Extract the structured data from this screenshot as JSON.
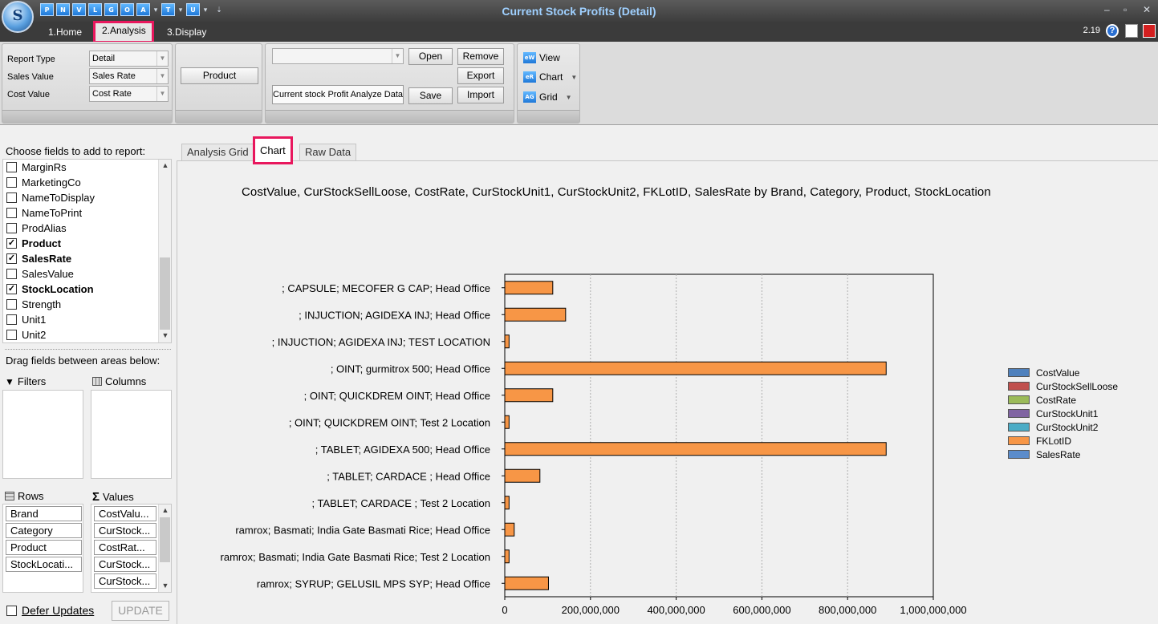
{
  "window": {
    "title": "Current Stock Profits (Detail)",
    "version": "2.19",
    "logo_text": "S",
    "quick_access": [
      "P",
      "N",
      "V",
      "L",
      "G",
      "O",
      "A",
      "T",
      "U"
    ]
  },
  "menu_tabs": [
    "1.Home",
    "2.Analysis",
    "3.Display"
  ],
  "ribbon": {
    "report_type_label": "Report Type",
    "report_type_value": "Detail",
    "sales_value_label": "Sales Value",
    "sales_value_value": "Sales Rate",
    "cost_value_label": "Cost Value",
    "cost_value_value": "Cost Rate",
    "product_button": "Product",
    "layout_select": "",
    "layout_name": "Current stock Profit Analyze Data",
    "open_button": "Open",
    "remove_button": "Remove",
    "export_button": "Export",
    "save_button": "Save",
    "import_button": "Import",
    "view_button": "View",
    "chart_button": "Chart",
    "grid_button": "Grid"
  },
  "field_panel": {
    "choose_label": "Choose fields to add to report:",
    "fields": [
      {
        "name": "MarginRs",
        "checked": false
      },
      {
        "name": "MarketingCo",
        "checked": false
      },
      {
        "name": "NameToDisplay",
        "checked": false
      },
      {
        "name": "NameToPrint",
        "checked": false
      },
      {
        "name": "ProdAlias",
        "checked": false
      },
      {
        "name": "Product",
        "checked": true
      },
      {
        "name": "SalesRate",
        "checked": true
      },
      {
        "name": "SalesValue",
        "checked": false
      },
      {
        "name": "StockLocation",
        "checked": true
      },
      {
        "name": "Strength",
        "checked": false
      },
      {
        "name": "Unit1",
        "checked": false
      },
      {
        "name": "Unit2",
        "checked": false
      }
    ],
    "drag_label": "Drag fields between areas below:",
    "filters_label": "Filters",
    "columns_label": "Columns",
    "rows_label": "Rows",
    "values_label": "Values",
    "rows": [
      "Brand",
      "Category",
      "Product",
      "StockLocati..."
    ],
    "values": [
      "CostValu...",
      "CurStock...",
      "CostRat...",
      "CurStock...",
      "CurStock..."
    ],
    "defer_label": "Defer Updates",
    "update_button": "UPDATE"
  },
  "content_tabs": [
    "Analysis Grid",
    "Chart",
    "Raw Data"
  ],
  "chart_data": {
    "type": "bar",
    "orientation": "horizontal",
    "title": "CostValue,  CurStockSellLoose,  CostRate,  CurStockUnit1,  CurStockUnit2,  FKLotID,  SalesRate by Brand,  Category,  Product,  StockLocation",
    "categories": [
      "; CAPSULE; MECOFER G CAP; Head Office",
      "; INJUCTION; AGIDEXA INJ; Head Office",
      "; INJUCTION; AGIDEXA INJ; TEST LOCATION",
      "; OINT; gurmitrox 500; Head Office",
      "; OINT; QUICKDREM OINT; Head Office",
      "; OINT; QUICKDREM OINT; Test 2 Location",
      "; TABLET; AGIDEXA 500; Head Office",
      "; TABLET; CARDACE ; Head Office",
      "; TABLET; CARDACE ; Test 2 Location",
      "ramrox; Basmati; India Gate Basmati Rice; Head Office",
      "ramrox; Basmati; India Gate Basmati Rice; Test 2 Location",
      "ramrox; SYRUP; GELUSIL MPS SYP; Head Office"
    ],
    "series": [
      {
        "name": "CostValue",
        "color": "#4f81bd",
        "values": [
          0,
          0,
          0,
          0,
          0,
          0,
          0,
          0,
          0,
          0,
          0,
          0
        ]
      },
      {
        "name": "CurStockSellLoose",
        "color": "#c0504d",
        "values": [
          0,
          0,
          0,
          0,
          0,
          0,
          0,
          0,
          0,
          0,
          0,
          0
        ]
      },
      {
        "name": "CostRate",
        "color": "#9bbb59",
        "values": [
          0,
          0,
          0,
          0,
          0,
          0,
          0,
          0,
          0,
          0,
          0,
          0
        ]
      },
      {
        "name": "CurStockUnit1",
        "color": "#8064a2",
        "values": [
          0,
          0,
          0,
          0,
          0,
          0,
          0,
          0,
          0,
          0,
          0,
          0
        ]
      },
      {
        "name": "CurStockUnit2",
        "color": "#4bacc6",
        "values": [
          0,
          0,
          0,
          0,
          0,
          0,
          0,
          0,
          0,
          0,
          0,
          0
        ]
      },
      {
        "name": "FKLotID",
        "color": "#f79646",
        "values": [
          112000000,
          142000000,
          10000000,
          890000000,
          112000000,
          10000000,
          890000000,
          82000000,
          10000000,
          22000000,
          10000000,
          102000000
        ]
      },
      {
        "name": "SalesRate",
        "color": "#5b8ccb",
        "values": [
          0,
          0,
          0,
          0,
          0,
          0,
          0,
          0,
          0,
          0,
          0,
          0
        ]
      }
    ],
    "xlim": [
      0,
      1000000000
    ],
    "xticks": [
      "0",
      "200,000,000",
      "400,000,000",
      "600,000,000",
      "800,000,000",
      "1,000,000,000"
    ],
    "grid": "vertical dotted",
    "legend_position": "right"
  }
}
